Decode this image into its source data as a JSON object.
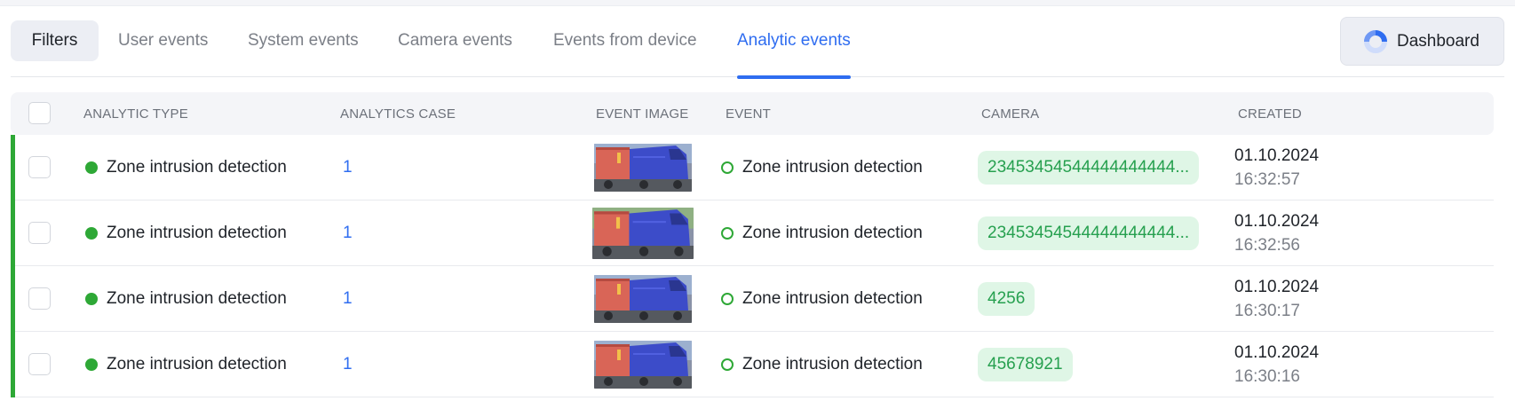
{
  "tabs": {
    "filters_label": "Filters",
    "items": [
      {
        "label": "User events",
        "active": false
      },
      {
        "label": "System events",
        "active": false
      },
      {
        "label": "Camera events",
        "active": false
      },
      {
        "label": "Events from device",
        "active": false
      },
      {
        "label": "Analytic events",
        "active": true
      }
    ],
    "dashboard_label": "Dashboard"
  },
  "table": {
    "columns": [
      "ANALYTIC TYPE",
      "ANALYTICS CASE",
      "EVENT IMAGE",
      "EVENT",
      "CAMERA",
      "CREATED"
    ],
    "rows": [
      {
        "analytic_type": "Zone intrusion detection",
        "analytics_case": "1",
        "event": "Zone intrusion detection",
        "camera": "23453454544444444444...",
        "date": "01.10.2024",
        "time": "16:32:57"
      },
      {
        "analytic_type": "Zone intrusion detection",
        "analytics_case": "1",
        "event": "Zone intrusion detection",
        "camera": "23453454544444444444...",
        "date": "01.10.2024",
        "time": "16:32:56"
      },
      {
        "analytic_type": "Zone intrusion detection",
        "analytics_case": "1",
        "event": "Zone intrusion detection",
        "camera": "4256",
        "date": "01.10.2024",
        "time": "16:30:17"
      },
      {
        "analytic_type": "Zone intrusion detection",
        "analytics_case": "1",
        "event": "Zone intrusion detection",
        "camera": "45678921",
        "date": "01.10.2024",
        "time": "16:30:16"
      }
    ]
  },
  "colors": {
    "accent": "#2f6df0",
    "status_green": "#2ea836",
    "badge_bg": "#dff6e6",
    "badge_text": "#26a04f"
  },
  "icons": {
    "dashboard": "dashboard-ring-icon",
    "row_status": "status-dot-icon",
    "event_status": "status-ring-icon"
  }
}
